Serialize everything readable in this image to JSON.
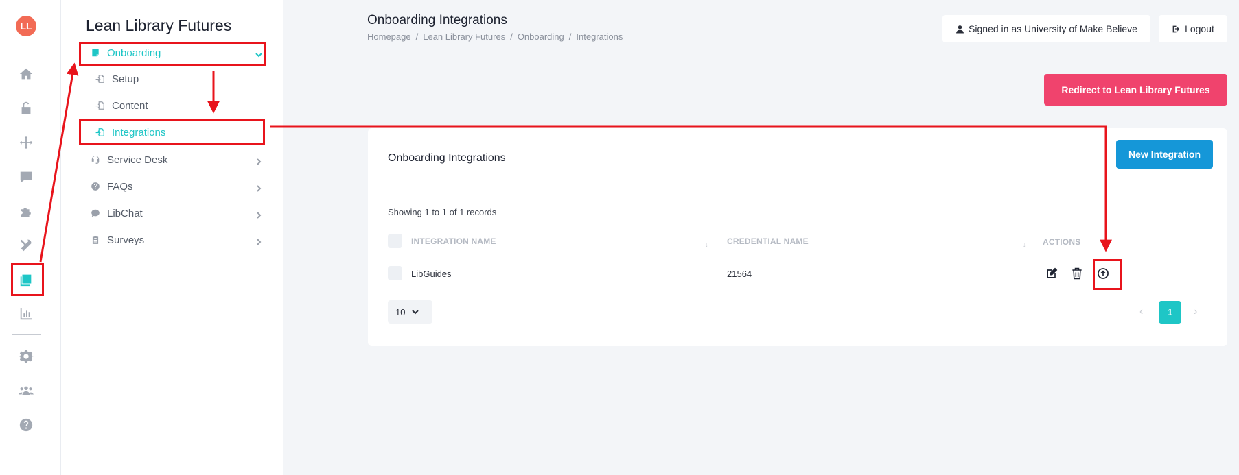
{
  "app": {
    "logo_text": "LL"
  },
  "rail": {
    "icons": [
      "home-icon",
      "unlock-icon",
      "move-icon",
      "comment-icon",
      "puzzle-icon",
      "tools-icon",
      "onboarding-icon",
      "chart-icon",
      "gear-icon",
      "users-icon",
      "help-icon"
    ]
  },
  "menu": {
    "title": "Lean Library Futures",
    "items": [
      {
        "label": "Onboarding",
        "icon": "onboarding-icon",
        "active": true
      },
      {
        "label": "Setup",
        "icon": "file-import-icon"
      },
      {
        "label": "Content",
        "icon": "file-import-icon"
      },
      {
        "label": "Integrations",
        "icon": "file-import-icon",
        "active": true
      },
      {
        "label": "Service Desk",
        "icon": "headset-icon"
      },
      {
        "label": "FAQs",
        "icon": "question-icon"
      },
      {
        "label": "LibChat",
        "icon": "comment-icon"
      },
      {
        "label": "Surveys",
        "icon": "clipboard-icon"
      }
    ]
  },
  "header": {
    "title": "Onboarding Integrations",
    "breadcrumb": [
      "Homepage",
      "Lean Library Futures",
      "Onboarding",
      "Integrations"
    ],
    "breadcrumb_sep": "/",
    "signed_in": "Signed in as University of Make Believe",
    "logout": "Logout",
    "redirect": "Redirect to Lean Library Futures"
  },
  "card": {
    "title": "Onboarding Integrations",
    "new_button": "New Integration",
    "showing": "Showing 1 to 1 of 1 records",
    "columns": [
      "INTEGRATION NAME",
      "CREDENTIAL NAME",
      "ACTIONS"
    ],
    "rows": [
      {
        "integration_name": "LibGuides",
        "credential_name": "21564"
      }
    ],
    "page_size": "10",
    "current_page": "1",
    "prev_symbol": "‹",
    "next_symbol": "›"
  },
  "colors": {
    "accent": "#1ec6c6",
    "redirect": "#f0436d",
    "primary": "#1597d8",
    "annotation": "#e8141c"
  }
}
